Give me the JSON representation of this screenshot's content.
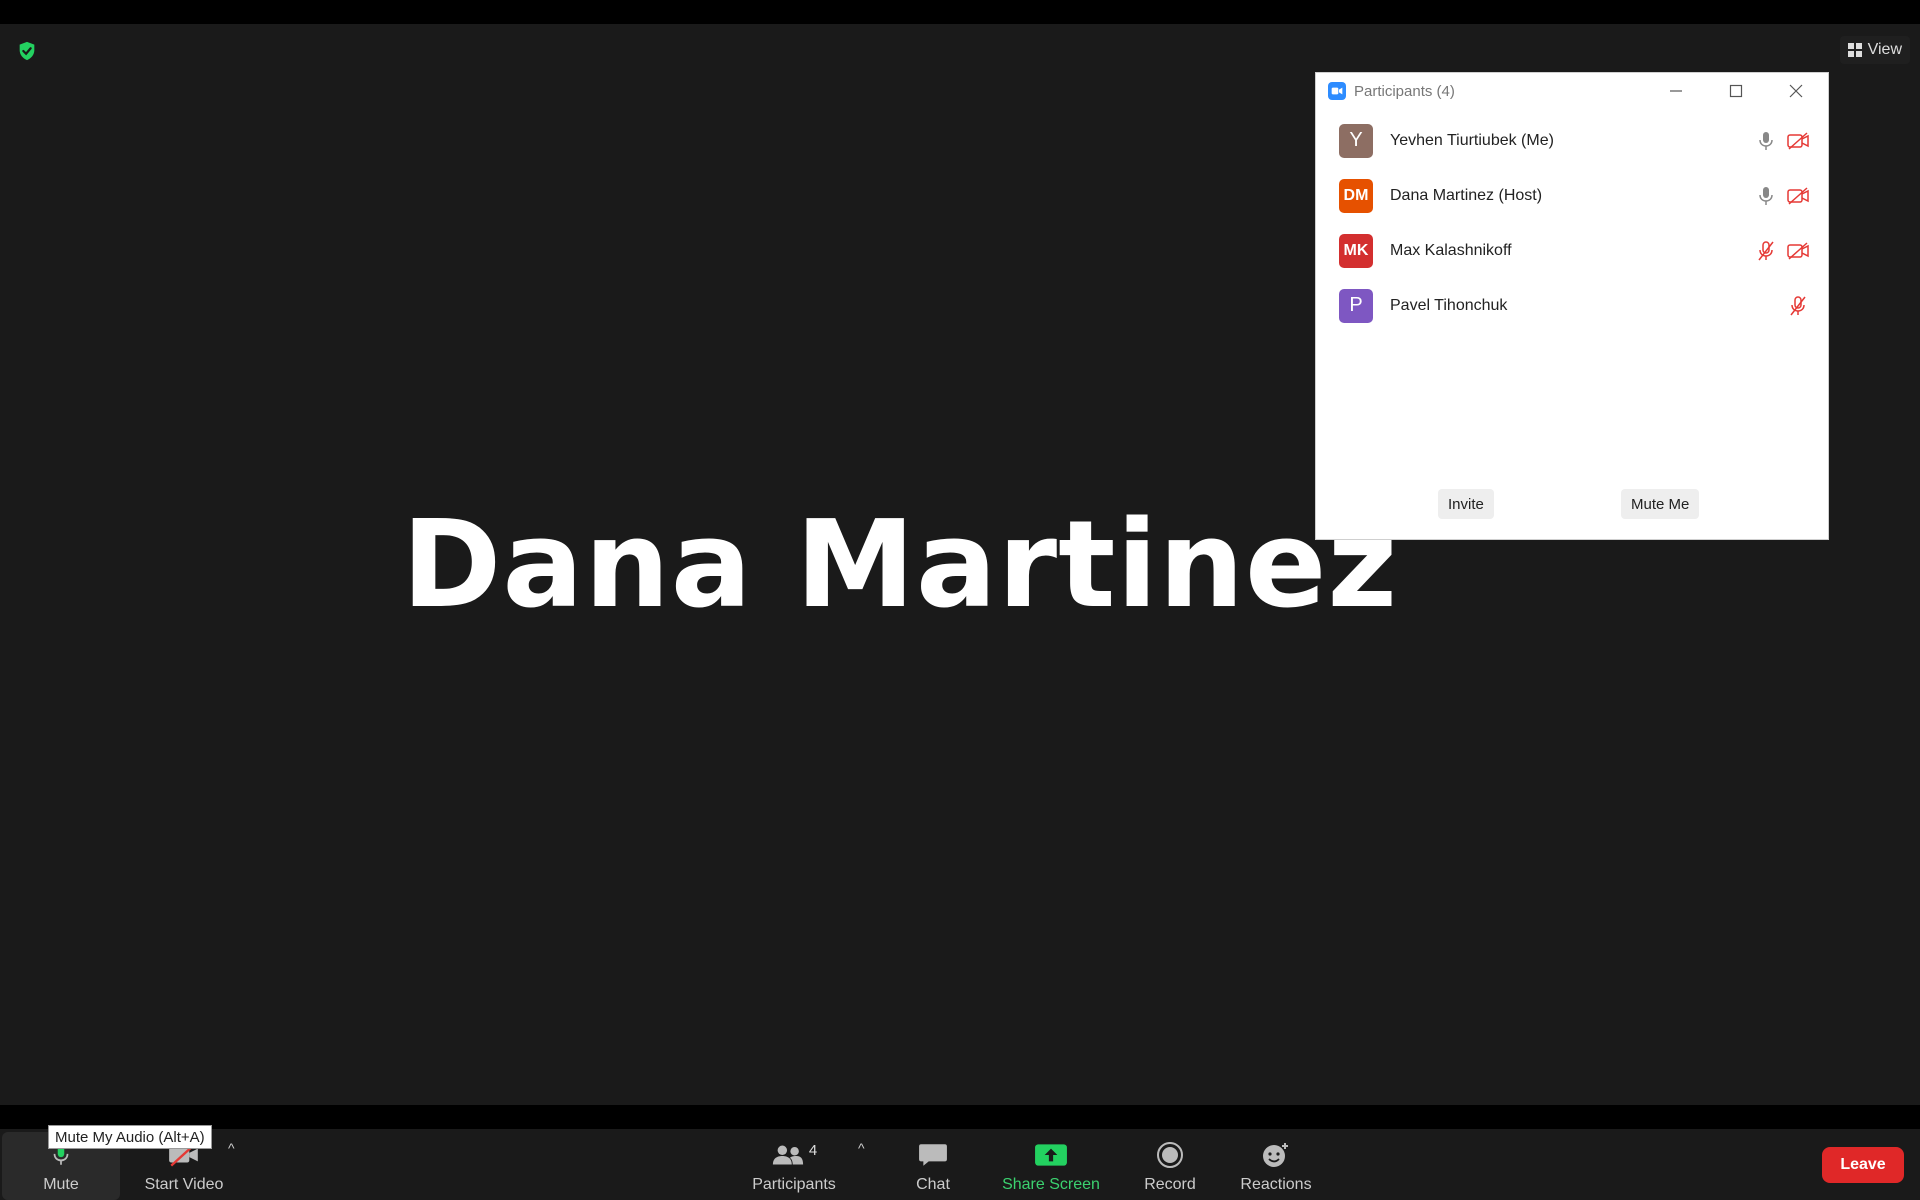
{
  "meeting": {
    "speaker_name": "Dana Martinez",
    "view_label": "View"
  },
  "participants_panel": {
    "title": "Participants (4)",
    "participants": [
      {
        "initials": "Y",
        "name": "Yevhen Tiurtiubek (Me)",
        "avatar_color": "#8d6e63",
        "mic": "on",
        "video": "off"
      },
      {
        "initials": "DM",
        "name": "Dana Martinez (Host)",
        "avatar_color": "#e65100",
        "mic": "on",
        "video": "off"
      },
      {
        "initials": "MK",
        "name": "Max Kalashnikoff",
        "avatar_color": "#d32f2f",
        "mic": "muted",
        "video": "off"
      },
      {
        "initials": "P",
        "name": "Pavel Tihonchuk",
        "avatar_color": "#7e57c2",
        "mic": "muted",
        "video": "none"
      }
    ],
    "invite_label": "Invite",
    "mute_me_label": "Mute Me"
  },
  "toolbar": {
    "mute_label": "Mute",
    "start_video_label": "Start Video",
    "participants_label": "Participants",
    "participants_count": "4",
    "chat_label": "Chat",
    "share_screen_label": "Share Screen",
    "record_label": "Record",
    "reactions_label": "Reactions",
    "leave_label": "Leave",
    "tooltip": "Mute My Audio (Alt+A)"
  },
  "colors": {
    "accent_green": "#23d160",
    "mute_red": "#e53935",
    "leave_red": "#e02828",
    "zoom_blue": "#2d8cff"
  }
}
